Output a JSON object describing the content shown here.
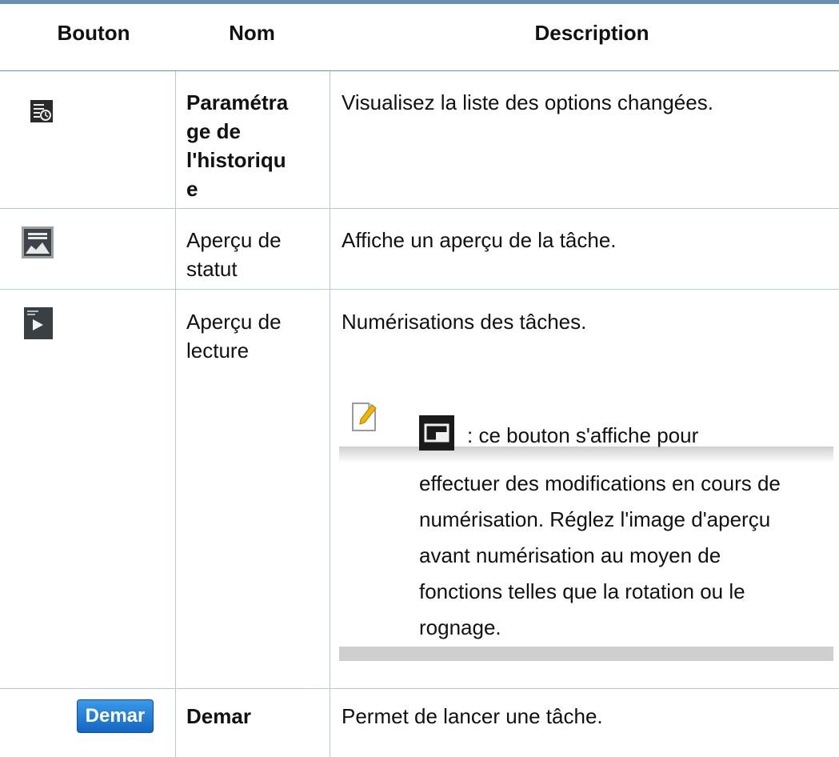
{
  "table": {
    "headers": {
      "button": "Bouton",
      "name": "Nom",
      "description": "Description"
    },
    "rows": [
      {
        "icon": "history-settings-icon",
        "name_lines": [
          "Paramétra",
          "ge de",
          "l'historiqu",
          "e"
        ],
        "description": "Visualisez la liste des options changées."
      },
      {
        "icon": "status-preview-icon",
        "name_lines": [
          "Aperçu de",
          "statut"
        ],
        "description": "Affiche un aperçu de la tâche."
      },
      {
        "icon": "play-preview-icon",
        "name_lines": [
          "Aperçu de",
          "lecture"
        ],
        "description": "Numérisations des tâches."
      },
      {
        "button_label": "Demar",
        "name_lines": [
          "Demar"
        ],
        "description": "Permet de lancer une tâche."
      }
    ]
  },
  "note": {
    "icon": "note-icon",
    "inline_icon": "edit-preview-icon",
    "lines": [
      ": ce bouton s'affiche pour",
      "effectuer des modifications en cours de",
      "numérisation. Réglez l'image d'aperçu",
      "avant numérisation au moyen de",
      "fonctions telles que la rotation ou le",
      "rognage."
    ]
  },
  "colors": {
    "rule": "#6b8fb0",
    "grid": "#b9c8d6",
    "button_blue": "#1466c2"
  }
}
